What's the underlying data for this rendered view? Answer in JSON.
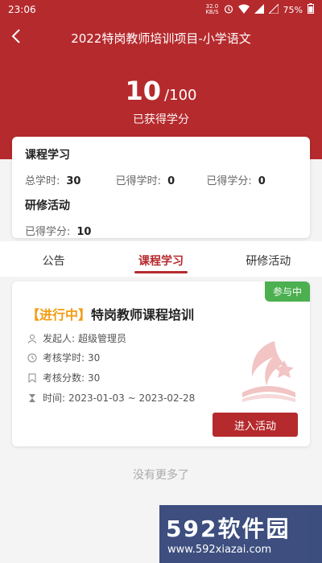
{
  "status_bar": {
    "time": "23:06",
    "net_speed_top": "32.0",
    "net_speed_bottom": "KB/S",
    "battery": "75%"
  },
  "nav": {
    "title": "2022特岗教师培训项目-小学语文"
  },
  "score": {
    "earned": "10",
    "total": "/100",
    "caption": "已获得学分"
  },
  "summary": {
    "course_title": "课程学习",
    "total_hours_label": "总学时:",
    "total_hours": "30",
    "earned_hours_label": "已得学时:",
    "earned_hours": "0",
    "earned_credits_label": "已得学分:",
    "earned_credits": "0",
    "training_title": "研修活动",
    "training_credits_label": "已得学分:",
    "training_credits": "10"
  },
  "tabs": [
    {
      "label": "公告"
    },
    {
      "label": "课程学习"
    },
    {
      "label": "研修活动"
    }
  ],
  "activity": {
    "badge": "参与中",
    "state": "【进行中】",
    "title": "特岗教师课程培训",
    "initiator_label": "发起人:",
    "initiator": "超级管理员",
    "hours_label": "考核学时:",
    "hours": "30",
    "score_label": "考核分数:",
    "score": "30",
    "time_label": "时间:",
    "time_range": "2023-01-03 ~ 2023-02-28",
    "button": "进入活动"
  },
  "no_more": "没有更多了",
  "watermark": {
    "brand": "592软件园",
    "url": "www.592xiazai.com"
  },
  "colors": {
    "primary": "#b52a2d",
    "badge": "#4caf50",
    "state": "#f39c12"
  }
}
